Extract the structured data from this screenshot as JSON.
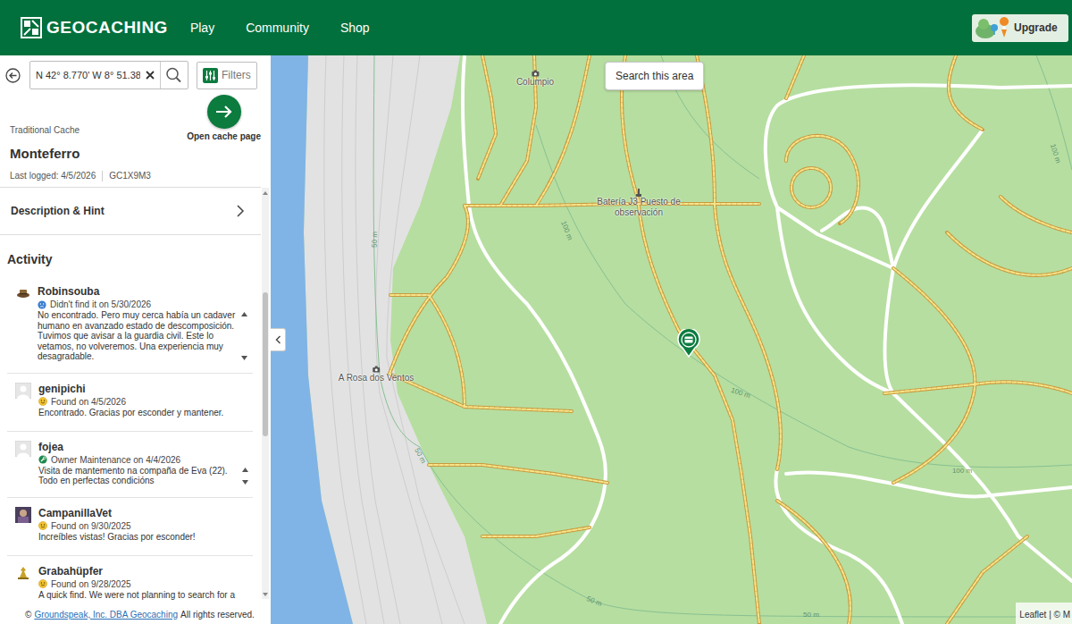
{
  "header": {
    "logo": "GEOCACHING",
    "nav": [
      {
        "label": "Play"
      },
      {
        "label": "Community"
      },
      {
        "label": "Shop"
      }
    ],
    "upgrade": "Upgrade"
  },
  "search": {
    "value": "N 42° 8.770' W 8° 51.38",
    "filters": "Filters"
  },
  "cache": {
    "open_label": "Open cache page",
    "type": "Traditional Cache",
    "name": "Monteferro",
    "last_logged": "Last logged: 4/5/2026",
    "code": "GC1X9M3"
  },
  "description": {
    "label": "Description & Hint"
  },
  "activity": {
    "title": "Activity",
    "logs": [
      {
        "user": "Robinsouba",
        "kind": "dnf",
        "type": "Didn't find it on 5/30/2026",
        "text": "No encontrado. Pero muy cerca había un cadaver humano en avanzado estado de descomposición. Tuvimos que avisar a la guardia civil. Este lo vetamos, no volveremos. Una experiencia muy desagradable.",
        "scrollable": true
      },
      {
        "user": "genipichi",
        "kind": "found",
        "type": "Found on 4/5/2026",
        "text": "Encontrado. Gracias por esconder y mantener.",
        "scrollable": false
      },
      {
        "user": "fojea",
        "kind": "maintenance",
        "type": "Owner Maintenance on 4/4/2026",
        "text": "Visita de mantemento na compaña de Eva (22). Todo en perfectas condicións",
        "scrollable": true
      },
      {
        "user": "CampanillaVet",
        "kind": "found",
        "type": "Found on 9/30/2025",
        "text": "Increíbles vistas! Gracias por esconder!",
        "scrollable": false
      },
      {
        "user": "Grabahüpfer",
        "kind": "found",
        "type": "Found on 9/28/2025",
        "text": "A quick find. We were not planning to search for a",
        "scrollable": false
      }
    ]
  },
  "footer": {
    "symbol": "©",
    "link": "Groundspeak, Inc. DBA Geocaching",
    "rights": "All rights reserved."
  },
  "map": {
    "search_area": "Search this area",
    "pois": [
      "Columpio",
      "Batería J3 Puesto de observación",
      "A Rosa dos Ventos"
    ],
    "contours": [
      "50 m",
      "100 m",
      "100 m",
      "100 m",
      "50 m",
      "50 m",
      "50 m",
      "100 m"
    ],
    "attribution": "Leaflet | © M"
  }
}
